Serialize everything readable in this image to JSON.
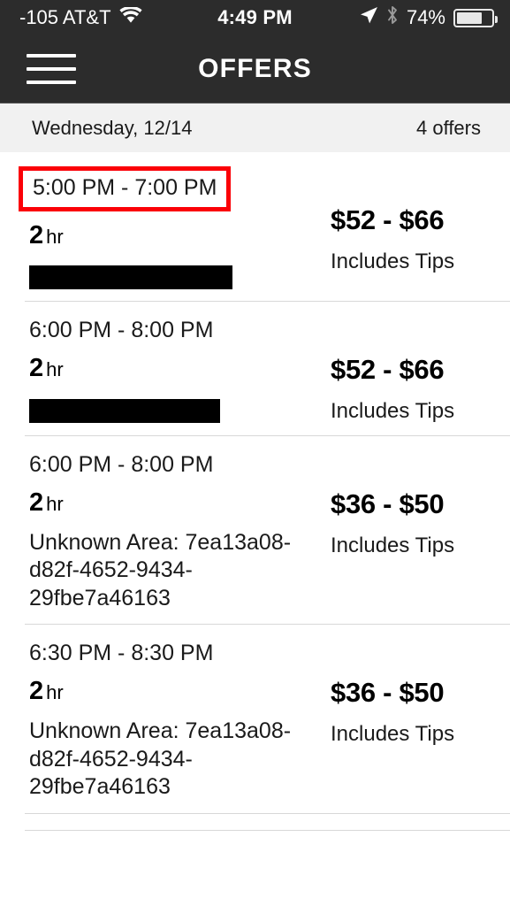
{
  "status_bar": {
    "carrier": "-105 AT&T",
    "wifi_icon": "wifi-icon",
    "time": "4:49 PM",
    "location_icon": "location-arrow-icon",
    "bluetooth_icon": "bluetooth-icon",
    "battery_percent": "74%",
    "battery_level": 74
  },
  "nav_bar": {
    "menu_icon": "hamburger-menu-icon",
    "title": "OFFERS"
  },
  "section_header": {
    "date": "Wednesday, 12/14",
    "count": "4 offers"
  },
  "offers": [
    {
      "time": "5:00 PM - 7:00 PM",
      "highlighted": true,
      "duration_value": "2",
      "duration_unit": "hr",
      "area": "",
      "redacted": true,
      "redaction_width": 230,
      "price": "$52 - $66",
      "tips": "Includes Tips"
    },
    {
      "time": "6:00 PM - 8:00 PM",
      "highlighted": false,
      "duration_value": "2",
      "duration_unit": "hr",
      "area": "",
      "redacted": true,
      "redaction_width": 216,
      "price": "$52 - $66",
      "tips": "Includes Tips"
    },
    {
      "time": "6:00 PM - 8:00 PM",
      "highlighted": false,
      "duration_value": "2",
      "duration_unit": "hr",
      "area": "Unknown Area: 7ea13a08-d82f-4652-9434-29fbe7a46163",
      "redacted": false,
      "redaction_width": 0,
      "price": "$36 - $50",
      "tips": "Includes Tips"
    },
    {
      "time": "6:30 PM - 8:30 PM",
      "highlighted": false,
      "duration_value": "2",
      "duration_unit": "hr",
      "area": "Unknown Area: 7ea13a08-d82f-4652-9434-29fbe7a46163",
      "redacted": false,
      "redaction_width": 0,
      "price": "$36 - $50",
      "tips": "Includes Tips"
    }
  ],
  "colors": {
    "nav_background": "#2c2c2c",
    "section_background": "#f1f1f1",
    "highlight_border": "#fb0007",
    "redaction": "#000000",
    "divider": "#d8d8d8"
  }
}
